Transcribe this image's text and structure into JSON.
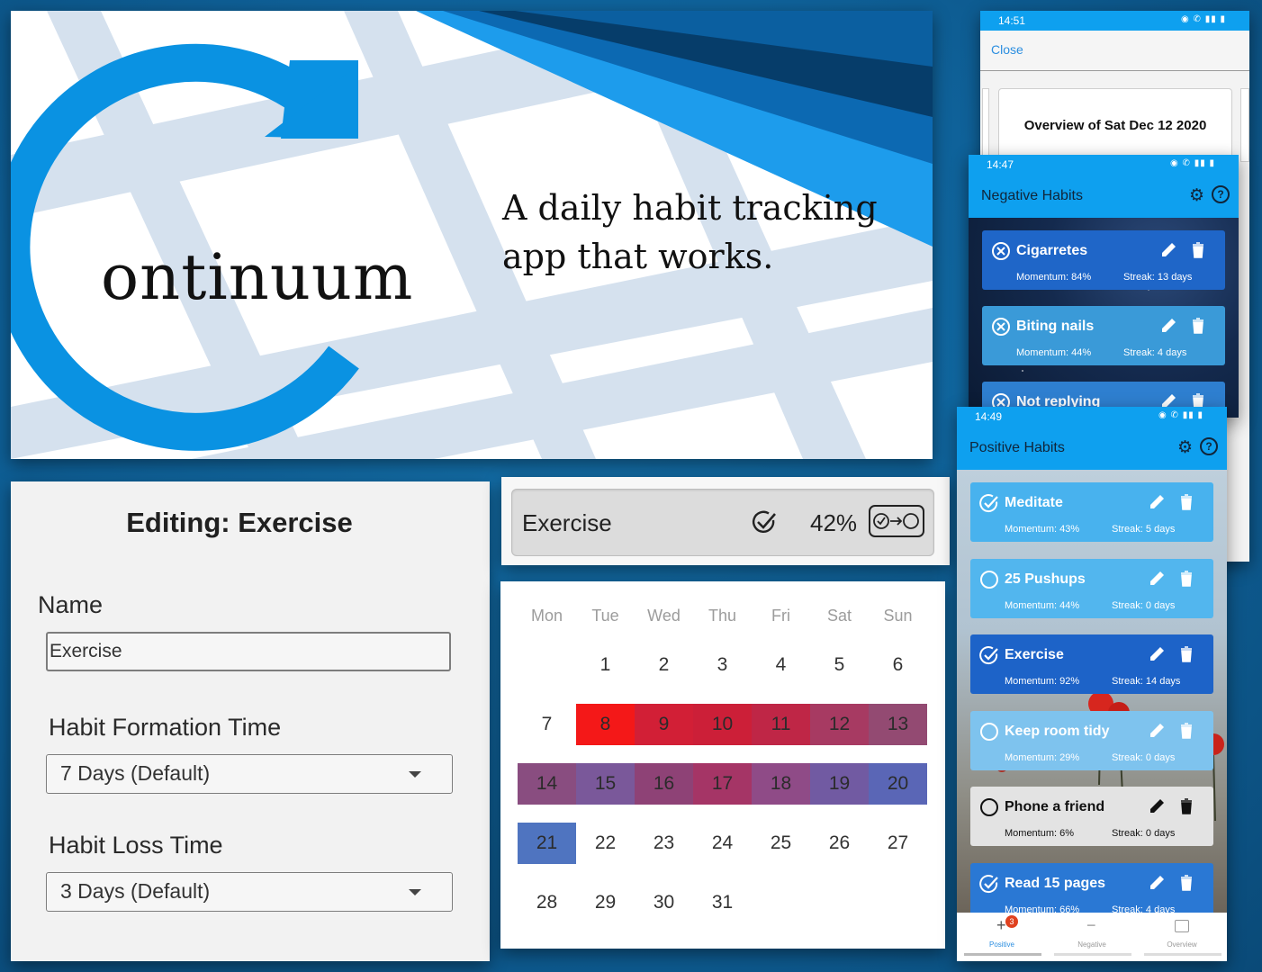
{
  "hero": {
    "logo_word": "ontinuum",
    "tagline": "A daily habit tracking app that works."
  },
  "editor": {
    "title": "Editing: Exercise",
    "name_label": "Name",
    "name_value": "Exercise",
    "formation_label": "Habit Formation Time",
    "formation_value": "7 Days (Default)",
    "loss_label": "Habit Loss Time",
    "loss_value": "3 Days (Default)"
  },
  "exercise": {
    "name": "Exercise",
    "percent": "42%"
  },
  "calendar": {
    "weekdays": [
      "Mon",
      "Tue",
      "Wed",
      "Thu",
      "Fri",
      "Sat",
      "Sun"
    ],
    "weeks": [
      [
        "",
        "1",
        "2",
        "3",
        "4",
        "5",
        "6"
      ],
      [
        "7",
        "8",
        "9",
        "10",
        "11",
        "12",
        "13"
      ],
      [
        "14",
        "15",
        "16",
        "17",
        "18",
        "19",
        "20"
      ],
      [
        "21",
        "22",
        "23",
        "24",
        "25",
        "26",
        "27"
      ],
      [
        "28",
        "29",
        "30",
        "31",
        "",
        "",
        ""
      ]
    ],
    "heat": {
      "8": "#f41818",
      "9": "#d21f36",
      "10": "#cc1f38",
      "11": "#bf2646",
      "12": "#a73a62",
      "13": "#934a72",
      "14": "#894d80",
      "15": "#7a589a",
      "16": "#8e4276",
      "17": "#a53566",
      "18": "#8f4b87",
      "19": "#715aa2",
      "20": "#5a66b6",
      "21": "#4f74c0"
    }
  },
  "overview_phone": {
    "time": "14:51",
    "close": "Close",
    "card_title": "Overview of Sat Dec 12 2020"
  },
  "negative_phone": {
    "time": "14:47",
    "title": "Negative Habits",
    "habits": [
      {
        "name": "Cigarretes",
        "momentum": "Momentum: 84%",
        "streak": "Streak: 13 days",
        "color": "#1f66c8"
      },
      {
        "name": "Biting nails",
        "momentum": "Momentum: 44%",
        "streak": "Streak: 4 days",
        "color": "#3a9ad8"
      },
      {
        "name": "Not replying",
        "momentum": "",
        "streak": "",
        "color": "#2e7fd0"
      }
    ]
  },
  "positive_phone": {
    "time": "14:49",
    "title": "Positive Habits",
    "habits": [
      {
        "name": "Meditate",
        "momentum": "Momentum: 43%",
        "streak": "Streak: 5 days",
        "done": true,
        "color": "#48b2ee"
      },
      {
        "name": "25 Pushups",
        "momentum": "Momentum: 44%",
        "streak": "Streak: 0 days",
        "done": false,
        "color": "#52b6ee"
      },
      {
        "name": "Exercise",
        "momentum": "Momentum: 92%",
        "streak": "Streak: 14 days",
        "done": true,
        "color": "#1d63c8"
      },
      {
        "name": "Keep room tidy",
        "momentum": "Momentum: 29%",
        "streak": "Streak: 0 days",
        "done": false,
        "color": "#7ec3ee"
      },
      {
        "name": "Phone a friend",
        "momentum": "Momentum: 6%",
        "streak": "Streak: 0 days",
        "done": false,
        "color": "#e3e3e3"
      },
      {
        "name": "Read 15 pages",
        "momentum": "Momentum: 66%",
        "streak": "Streak: 4 days",
        "done": true,
        "color": "#2a78d4"
      }
    ],
    "nav": {
      "positive": "Positive",
      "positive_badge": "3",
      "negative": "Negative",
      "overview": "Overview"
    }
  }
}
